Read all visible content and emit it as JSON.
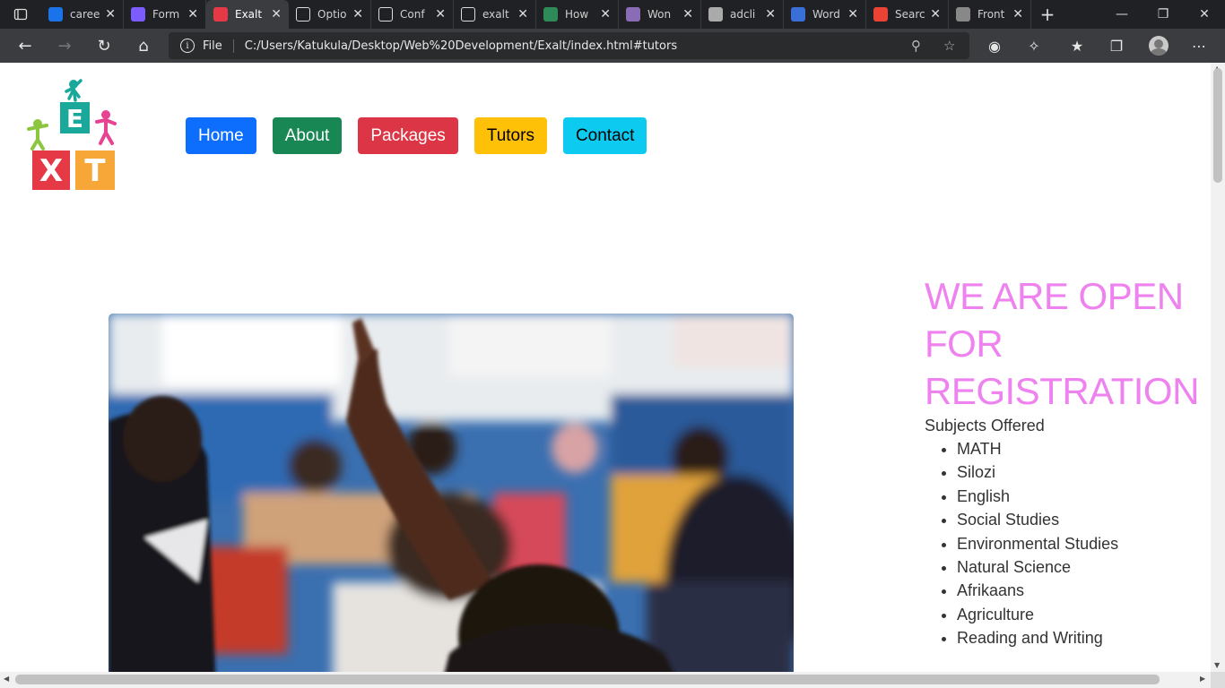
{
  "browser": {
    "tabs": [
      {
        "title": "caree",
        "favicon": "bing-icon",
        "color": "#1a73e8"
      },
      {
        "title": "Form",
        "favicon": "form-icon",
        "color": "#7c5cff"
      },
      {
        "title": "Exalt",
        "favicon": "exalt-icon",
        "color": "#e63946",
        "active": true
      },
      {
        "title": "Optio",
        "favicon": "github-icon",
        "color": "#ffffff"
      },
      {
        "title": "Conf",
        "favicon": "github-icon",
        "color": "#ffffff"
      },
      {
        "title": "exalt",
        "favicon": "file-icon",
        "color": "#ffffff"
      },
      {
        "title": "How",
        "favicon": "w-icon",
        "color": "#2e8b57"
      },
      {
        "title": "Won",
        "favicon": "page-icon",
        "color": "#8a6bb5"
      },
      {
        "title": "adcli",
        "favicon": "file-icon",
        "color": "#aaaaaa"
      },
      {
        "title": "Word",
        "favicon": "grid-icon",
        "color": "#3a6fd8"
      },
      {
        "title": "Searc",
        "favicon": "gmail-icon",
        "color": "#ea4335"
      },
      {
        "title": "Front",
        "favicon": "page-icon",
        "color": "#888888"
      }
    ],
    "address": {
      "scheme_label": "File",
      "url": "C:/Users/Katukula/Desktop/Web%20Development/Exalt/index.html#tutors"
    }
  },
  "site": {
    "logo_letters": [
      "E",
      "X",
      "T"
    ],
    "nav": [
      {
        "label": "Home",
        "bg": "#0d6efd",
        "fg": "#ffffff"
      },
      {
        "label": "About",
        "bg": "#198754",
        "fg": "#ffffff"
      },
      {
        "label": "Packages",
        "bg": "#dc3545",
        "fg": "#ffffff"
      },
      {
        "label": "Tutors",
        "bg": "#ffc107",
        "fg": "#000000"
      },
      {
        "label": "Contact",
        "bg": "#0dcaf0",
        "fg": "#000000"
      }
    ],
    "promo": {
      "heading": "WE ARE OPEN FOR REGISTRATION",
      "subjects_title": "Subjects Offered",
      "subjects": [
        "MATH",
        "Silozi",
        "English",
        "Social Studies",
        "Environmental Studies",
        "Natural Science",
        "Afrikaans",
        "Agriculture",
        "Reading and Writing"
      ]
    },
    "colors": {
      "heading": "#ee82ee"
    }
  }
}
